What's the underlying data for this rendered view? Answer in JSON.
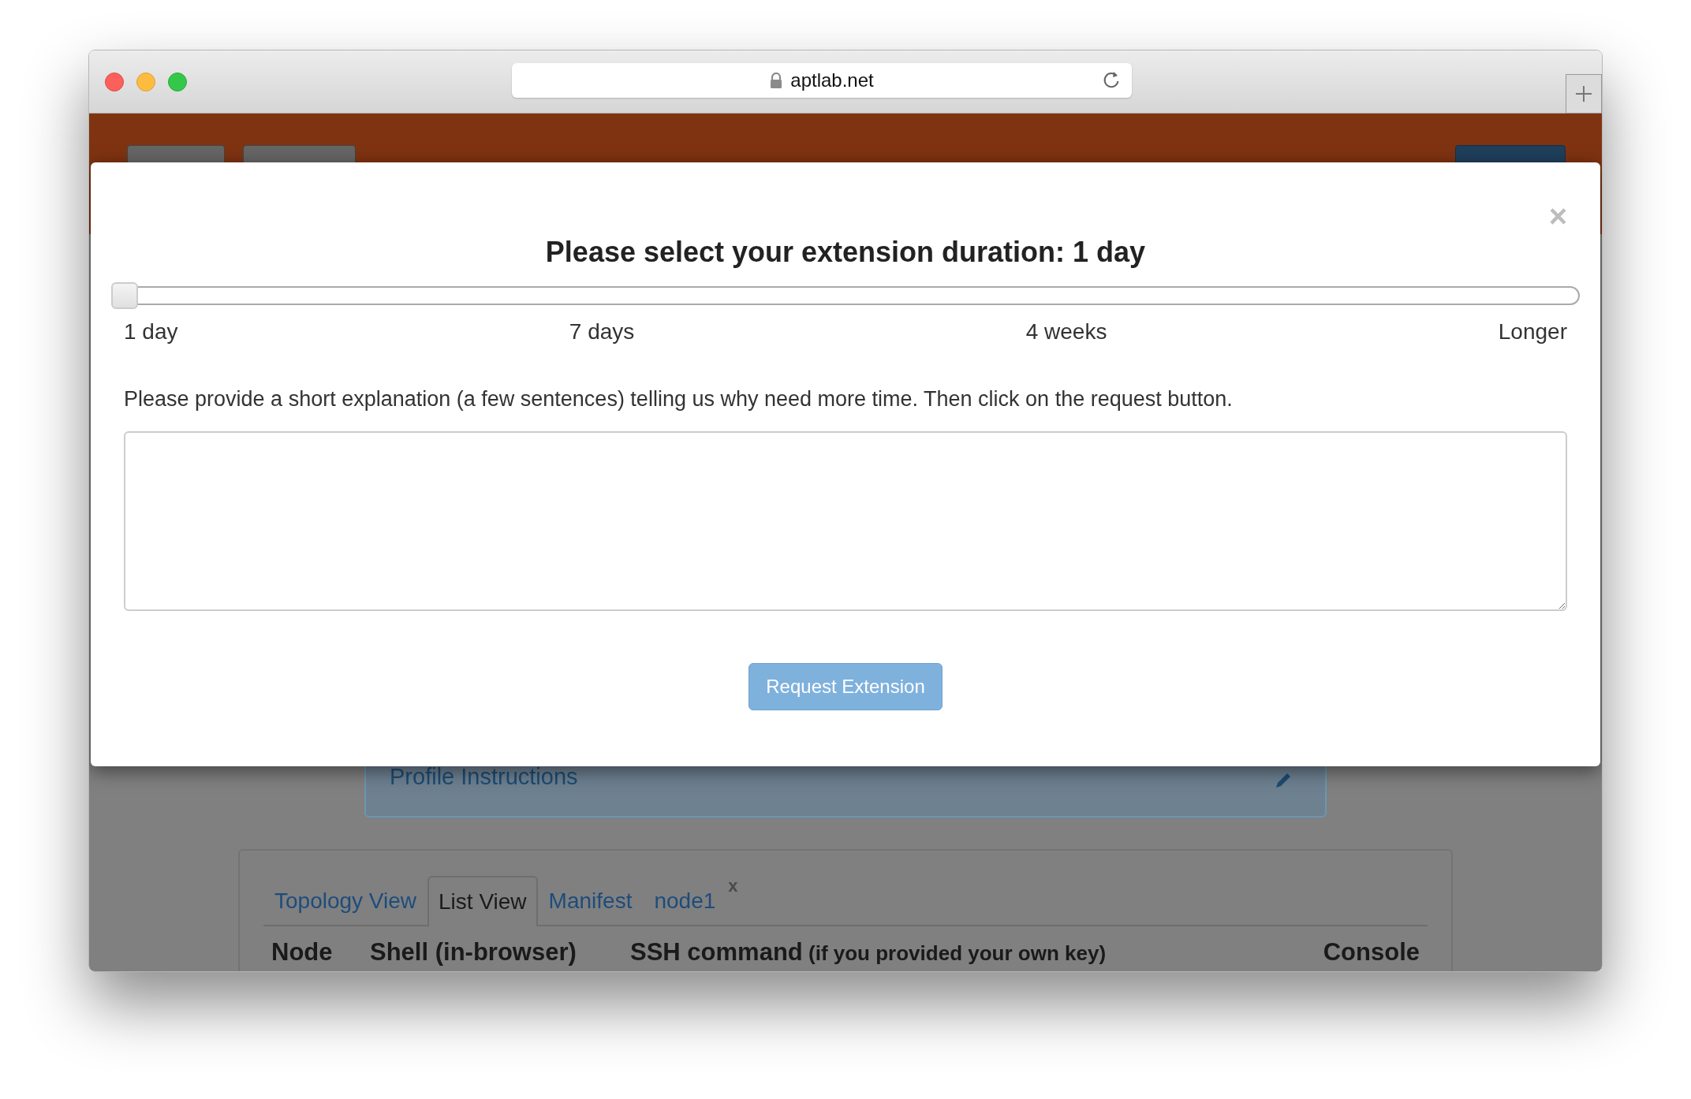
{
  "browser": {
    "url": "aptlab.net"
  },
  "dialog": {
    "close": "×",
    "title": "Please select your extension duration: 1 day",
    "slider": {
      "level": 0,
      "ticks": [
        "1 day",
        "7 days",
        "4 weeks",
        "Longer"
      ]
    },
    "instructions": "Please provide a short explanation (a few sentences) telling us why need more time. Then click on the request button.",
    "button": "Request Extension"
  },
  "background": {
    "panel_title": "Profile Instructions",
    "tabs": [
      {
        "label": "Topology View",
        "selected": false
      },
      {
        "label": "List View",
        "selected": true
      },
      {
        "label": "Manifest",
        "selected": false
      },
      {
        "label": "node1",
        "selected": false,
        "close": "x"
      }
    ],
    "columns": [
      {
        "label": "Node"
      },
      {
        "label": "Shell (in-browser)"
      },
      {
        "label": "SSH command",
        "note": "(if you provided your own key)"
      },
      {
        "label": "Console"
      }
    ]
  }
}
